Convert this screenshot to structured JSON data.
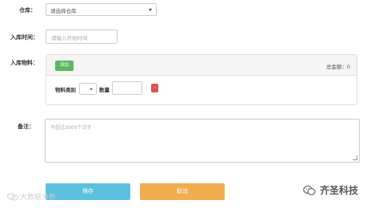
{
  "form": {
    "warehouse_label": "仓库：",
    "warehouse_value": "请选择仓库",
    "time_label": "入库时间：",
    "time_placeholder": "请输入开始时间",
    "material_label": "入库物料：",
    "add_button": "添加",
    "total": "总金额：0",
    "category_label": "物料类别",
    "quantity_label": "数量",
    "delete_button": "-",
    "remark_label": "备注：",
    "remark_placeholder": "不超过2000个汉字",
    "save_button": "保存",
    "cancel_button": "取消"
  },
  "watermarks": {
    "left": "大数据分析",
    "right": "齐圣科技"
  },
  "colors": {
    "add_button": "#5cb85c",
    "delete_button": "#d9534f",
    "save_button": "#5bc0de",
    "cancel_button": "#f0ad4e"
  }
}
